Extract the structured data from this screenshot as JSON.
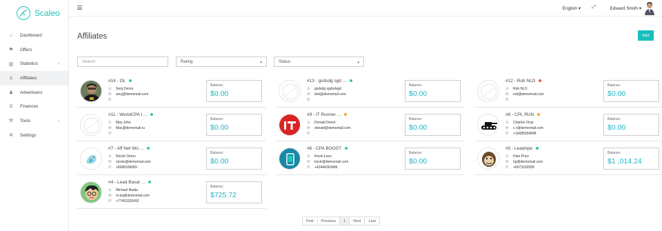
{
  "app": {
    "name": "Scaleo"
  },
  "sidebar": {
    "items": [
      {
        "label": "Dashboard",
        "icon": "home-icon",
        "glyph": "⌂",
        "chevron": false,
        "active": false
      },
      {
        "label": "Offers",
        "icon": "flag-icon",
        "glyph": "⚑",
        "chevron": false,
        "active": false
      },
      {
        "label": "Statistics",
        "icon": "bar-chart-icon",
        "glyph": "▥",
        "chevron": true,
        "active": false
      },
      {
        "label": "Affiliates",
        "icon": "user-icon",
        "glyph": "♙",
        "chevron": false,
        "active": true
      },
      {
        "label": "Advertisers",
        "icon": "person-icon",
        "glyph": "♟",
        "chevron": false,
        "active": false
      },
      {
        "label": "Finances",
        "icon": "bank-icon",
        "glyph": "⌸",
        "chevron": false,
        "active": false
      },
      {
        "label": "Tools",
        "icon": "wrench-icon",
        "glyph": "⚒",
        "chevron": true,
        "active": false
      },
      {
        "label": "Settings",
        "icon": "gear-icon",
        "glyph": "✲",
        "chevron": false,
        "active": false
      }
    ],
    "chevron_glyph": "›"
  },
  "topbar": {
    "language": "English ▾",
    "user_name": "Edward Smith ▾",
    "expand_glyph": "⤢"
  },
  "page": {
    "title": "Affiliates",
    "add_label": "Add"
  },
  "filters": {
    "search_placeholder": "Search",
    "rating_label": "Rating",
    "status_label": "Status",
    "caret": "▼"
  },
  "colors": {
    "accent": "#1bbfbf",
    "active": "#2ecc8f",
    "pending": "#f5a623",
    "inactive": "#e8554e"
  },
  "icons": {
    "user": "♙",
    "mail": "✉",
    "phone": "✆"
  },
  "balance_label": "Balance:",
  "affiliates": [
    {
      "title": "#14 - OL",
      "status": "active",
      "name": "Serg Demo",
      "email": "serg@demomail.com",
      "phone": "",
      "balance": "$0.00",
      "avatar": "photo-man-dark"
    },
    {
      "title": "#13 - gsdsdg sgd ...",
      "status": "active",
      "name": "gsdsdg sgdsdsgd",
      "email": "bnk@demomail.com",
      "phone": "",
      "balance": "$0.00",
      "avatar": "placeholder"
    },
    {
      "title": "#12 - Rob NLD",
      "status": "inactive",
      "name": "Rob NLD",
      "email": "rob@demomail.com",
      "phone": "",
      "balance": "$0.00",
      "avatar": "placeholder"
    },
    {
      "title": "#11 - WorldCPA I ...",
      "status": "active",
      "name": "Max John",
      "email": "Mac@demomail.ru",
      "phone": "",
      "balance": "$0.00",
      "avatar": "placeholder"
    },
    {
      "title": "#9 - IT Runner ...",
      "status": "pending",
      "name": "Donald Demo",
      "email": "donald@demomail.com",
      "phone": "",
      "balance": "$0.00",
      "avatar": "it-logo"
    },
    {
      "title": "#8 - CPL RUN",
      "status": "pending",
      "name": "Charles Vicar",
      "email": "c.v@demomail.com",
      "phone": "+16685654848",
      "balance": "$0.00",
      "avatar": "tank"
    },
    {
      "title": "#7 - Aff Net Wo ...",
      "status": "active",
      "name": "Nicole Demo",
      "email": "nicole@demomail.com",
      "phone": "+8945336089",
      "balance": "$0.00",
      "avatar": "bird"
    },
    {
      "title": "#6 - CPA BOOST",
      "status": "active",
      "name": "Kevin Lens",
      "email": "kevin@demomail.com",
      "phone": "+43444363486",
      "balance": "$0.00",
      "avatar": "phone-app"
    },
    {
      "title": "#5 - LeadApe",
      "status": "active",
      "name": "Hale Price",
      "email": "hp@demomail.com",
      "phone": "+8973332558",
      "balance": "$1 ,014.24",
      "avatar": "ape"
    },
    {
      "title": "#4 - Lead Basar ...",
      "status": "active",
      "name": "Michael Barda",
      "email": "m.ba@demomail.com",
      "phone": "+77453332492",
      "balance": "$725.72",
      "avatar": "cartoon-boy"
    }
  ],
  "pagination": {
    "items": [
      "First",
      "Previous",
      "1",
      "Next",
      "Last"
    ],
    "current": "1"
  }
}
